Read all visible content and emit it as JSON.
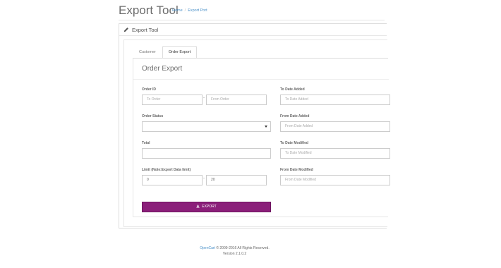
{
  "header": {
    "title": "Export Tool",
    "breadcrumb": [
      {
        "label": "Home"
      },
      {
        "label": "Export Port"
      }
    ]
  },
  "panel": {
    "title": "Export Tool",
    "tabs": [
      {
        "label": "Customer",
        "active": false
      },
      {
        "label": "Order Export",
        "active": true
      }
    ]
  },
  "form": {
    "section_title": "Order Export",
    "order_id": {
      "label": "Order ID",
      "to_placeholder": "To Order",
      "from_placeholder": "From Order",
      "separator": "-"
    },
    "order_status": {
      "label": "Order Status",
      "value": ""
    },
    "total": {
      "label": "Total",
      "value": ""
    },
    "limit": {
      "label": "Limit (Note:Export Data limit)",
      "start_value": "0",
      "end_value": "20",
      "separator": "-"
    },
    "to_date_added": {
      "label": "To Date Added",
      "placeholder": "To Date Added"
    },
    "from_date_added": {
      "label": "From Date Added",
      "placeholder": "From Date Added"
    },
    "to_date_modified": {
      "label": "To Date Modified",
      "placeholder": "To Date Modified"
    },
    "from_date_modified": {
      "label": "From Date Modified",
      "placeholder": "From Date Modified"
    },
    "export_button": {
      "label": "EXPORT",
      "icon": "download-icon"
    }
  },
  "footer": {
    "brand_link": "OpenCart",
    "copyright": "© 2009-2016 All Rights Reserved.",
    "version": "Version 2.1.0.2"
  },
  "colors": {
    "accent_button": "#8b1f7a",
    "link": "#4a90c8"
  }
}
